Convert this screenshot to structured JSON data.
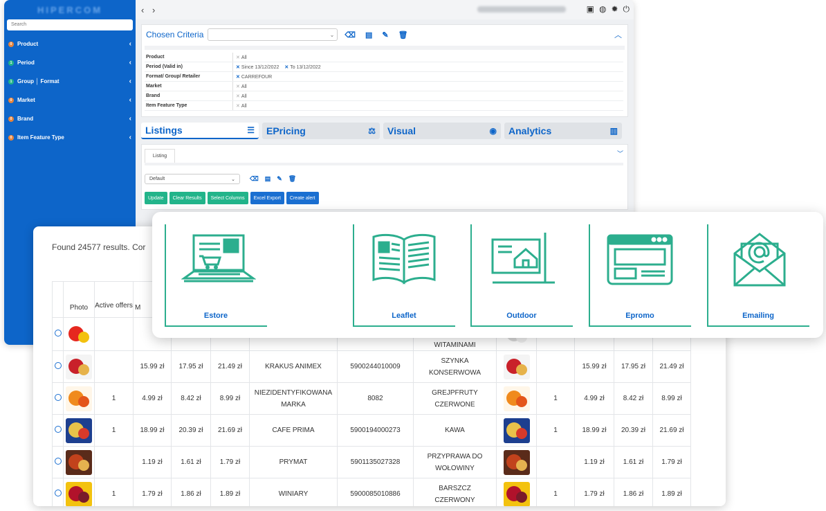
{
  "sidebar": {
    "search_placeholder": "Search",
    "items": [
      {
        "badge": "0",
        "badge_color": "#e8833a",
        "label": "Product"
      },
      {
        "badge": "1",
        "badge_color": "#22b48a",
        "label": "Period"
      },
      {
        "badge": "1",
        "badge_color": "#22b48a",
        "label": "Group │ Format"
      },
      {
        "badge": "0",
        "badge_color": "#e8833a",
        "label": "Market"
      },
      {
        "badge": "0",
        "badge_color": "#e8833a",
        "label": "Brand"
      },
      {
        "badge": "0",
        "badge_color": "#e8833a",
        "label": "Item Feature Type"
      }
    ]
  },
  "topbar": {
    "nav": "‹ ›"
  },
  "criteria": {
    "title": "Chosen Criteria",
    "rows": [
      {
        "key": "Product",
        "values": [
          {
            "x": "grey",
            "text": "All"
          }
        ]
      },
      {
        "key": "Period (Valid in)",
        "values": [
          {
            "x": "blue",
            "text": "Since 13/12/2022"
          },
          {
            "x": "blue",
            "text": "To 13/12/2022"
          }
        ]
      },
      {
        "key": "Format/ Group/ Retailer",
        "values": [
          {
            "x": "blue",
            "text": "CARREFOUR"
          }
        ]
      },
      {
        "key": "Market",
        "values": [
          {
            "x": "grey",
            "text": "All"
          }
        ]
      },
      {
        "key": "Brand",
        "values": [
          {
            "x": "grey",
            "text": "All"
          }
        ]
      },
      {
        "key": "Item Feature Type",
        "values": [
          {
            "x": "grey",
            "text": "All"
          }
        ]
      }
    ]
  },
  "tabs": [
    {
      "label": "Listings",
      "icon": "list-icon"
    },
    {
      "label": "EPricing",
      "icon": "scale-icon"
    },
    {
      "label": "Visual",
      "icon": "eye-icon"
    },
    {
      "label": "Analytics",
      "icon": "bar-chart-icon"
    }
  ],
  "listing": {
    "tab_label": "Listing",
    "select_value": "Default",
    "buttons": [
      {
        "label": "Update",
        "style": "g"
      },
      {
        "label": "Clear Results",
        "style": "g"
      },
      {
        "label": "Select Columns",
        "style": "g"
      },
      {
        "label": "Excel Export",
        "style": "b"
      },
      {
        "label": "Create alert",
        "style": "b"
      }
    ]
  },
  "results": {
    "found_text": "Found 24577 results. Cor",
    "headers": {
      "photo": "Photo",
      "active": "Active offers",
      "m": "M"
    },
    "row0_partial": "WITAMINAMI",
    "rows": [
      {
        "active": "",
        "p1": "15.99 zł",
        "p2": "17.95 zł",
        "p3": "21.49 zł",
        "brand": "KRAKUS ANIMEX",
        "ean": "5900244010009",
        "name": [
          "SZYNKA",
          "KONSERWOWA"
        ],
        "active2": "",
        "q1": "15.99 zł",
        "q2": "17.95 zł",
        "q3": "21.49 zł",
        "thumb": [
          "#f4f4f4",
          "#c9212a",
          "#e6b24a"
        ]
      },
      {
        "active": "1",
        "p1": "4.99 zł",
        "p2": "8.42 zł",
        "p3": "8.99 zł",
        "brand": [
          "NIEZIDENTYFIKOWANA",
          "MARKA"
        ],
        "ean": "8082",
        "name": [
          "GREJPFRUTY",
          "CZERWONE"
        ],
        "active2": "1",
        "q1": "4.99 zł",
        "q2": "8.42 zł",
        "q3": "8.99 zł",
        "thumb": [
          "#fff6e8",
          "#f08a1d",
          "#e4551a"
        ]
      },
      {
        "active": "1",
        "p1": "18.99 zł",
        "p2": "20.39 zł",
        "p3": "21.69 zł",
        "brand": "CAFE PRIMA",
        "ean": "5900194000273",
        "name": [
          "KAWA"
        ],
        "active2": "1",
        "q1": "18.99 zł",
        "q2": "20.39 zł",
        "q3": "21.69 zł",
        "thumb": [
          "#1d3f8f",
          "#e9c24a",
          "#d73a2a"
        ]
      },
      {
        "active": "",
        "p1": "1.19 zł",
        "p2": "1.61 zł",
        "p3": "1.79 zł",
        "brand": "PRYMAT",
        "ean": "5901135027328",
        "name": [
          "PRZYPRAWA DO",
          "WOŁOWINY"
        ],
        "active2": "",
        "q1": "1.19 zł",
        "q2": "1.61 zł",
        "q3": "1.79 zł",
        "thumb": [
          "#5a2b1a",
          "#c2421c",
          "#e5b24f"
        ]
      },
      {
        "active": "1",
        "p1": "1.79 zł",
        "p2": "1.86 zł",
        "p3": "1.89 zł",
        "brand": "WINIARY",
        "ean": "5900085010886",
        "name": [
          "BARSZCZ",
          "CZERWONY"
        ],
        "active2": "1",
        "q1": "1.79 zł",
        "q2": "1.86 zł",
        "q3": "1.89 zł",
        "thumb": [
          "#f3c20f",
          "#b1122b",
          "#7a1b2a"
        ]
      }
    ]
  },
  "channels": [
    {
      "label": "Estore",
      "icon": "laptop-cart-icon"
    },
    {
      "label": "Leaflet",
      "icon": "open-book-icon"
    },
    {
      "label": "Outdoor",
      "icon": "billboard-house-icon"
    },
    {
      "label": "Epromo",
      "icon": "browser-window-icon"
    },
    {
      "label": "Emailing",
      "icon": "envelope-at-icon"
    }
  ],
  "colors": {
    "brand_blue": "#0d65c9",
    "accent_green": "#2cae8e",
    "button_green": "#22b48a"
  }
}
